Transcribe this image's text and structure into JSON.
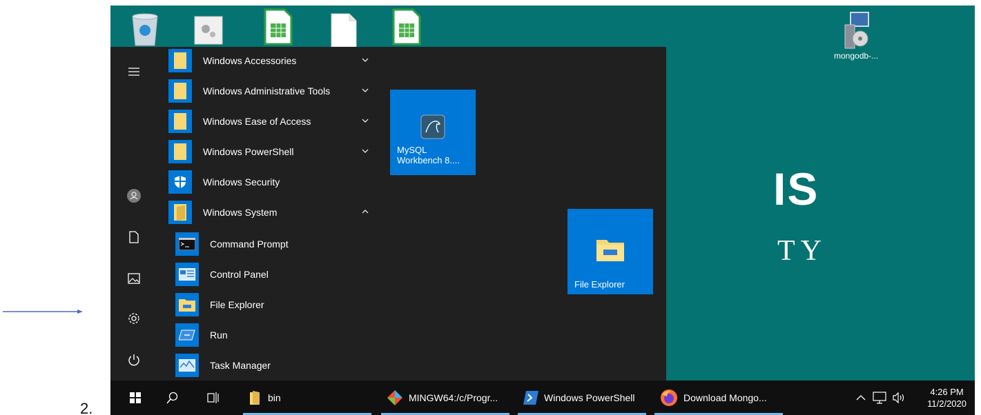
{
  "annotation": {
    "step_number": "2."
  },
  "wallpaper": {
    "text_line1": "IS",
    "text_line2": "TY"
  },
  "desktop": {
    "icons": [
      {
        "name": "recycle-bin-icon",
        "label": ""
      },
      {
        "name": "settings-file-icon",
        "label": ""
      },
      {
        "name": "spreadsheet-file-icon",
        "label": ""
      },
      {
        "name": "blank-file-icon",
        "label": ""
      },
      {
        "name": "spreadsheet-file-icon-2",
        "label": ""
      },
      {
        "name": "mongodb-installer-icon",
        "label": "mongodb-..."
      }
    ]
  },
  "start_menu": {
    "apps": [
      {
        "label": "Windows Accessories",
        "icon": "folder-icon",
        "chevron": "down"
      },
      {
        "label": "Windows Administrative Tools",
        "icon": "folder-icon",
        "chevron": "down"
      },
      {
        "label": "Windows Ease of Access",
        "icon": "folder-icon",
        "chevron": "down"
      },
      {
        "label": "Windows PowerShell",
        "icon": "folder-icon",
        "chevron": "down"
      },
      {
        "label": "Windows Security",
        "icon": "shield-icon",
        "chevron": ""
      },
      {
        "label": "Windows System",
        "icon": "folder-open-icon",
        "chevron": "up"
      }
    ],
    "system_items": [
      {
        "label": "Command Prompt",
        "icon": "cmd-icon"
      },
      {
        "label": "Control Panel",
        "icon": "control-panel-icon"
      },
      {
        "label": "File Explorer",
        "icon": "file-explorer-icon"
      },
      {
        "label": "Run",
        "icon": "run-icon"
      },
      {
        "label": "Task Manager",
        "icon": "task-manager-icon"
      }
    ],
    "tiles": {
      "mysql": {
        "line1": "MySQL",
        "line2": "Workbench 8...."
      },
      "explorer": {
        "label": "File Explorer"
      }
    },
    "rail": [
      "hamburger-icon",
      "user-icon",
      "documents-icon",
      "pictures-icon",
      "settings-icon",
      "power-icon"
    ]
  },
  "taskbar": {
    "items": [
      {
        "label": "bin",
        "icon": "folder-icon"
      },
      {
        "label": "MINGW64:/c/Progr...",
        "icon": "git-icon"
      },
      {
        "label": "Windows PowerShell",
        "icon": "powershell-icon"
      },
      {
        "label": "Download Mongo...",
        "icon": "firefox-icon"
      }
    ],
    "clock": {
      "time": "4:26 PM",
      "date": "11/2/2020"
    }
  },
  "colors": {
    "teal_wallpaper": "#057371",
    "menu_bg": "#202020",
    "accent": "#0078d7",
    "taskbar": "#101010"
  }
}
